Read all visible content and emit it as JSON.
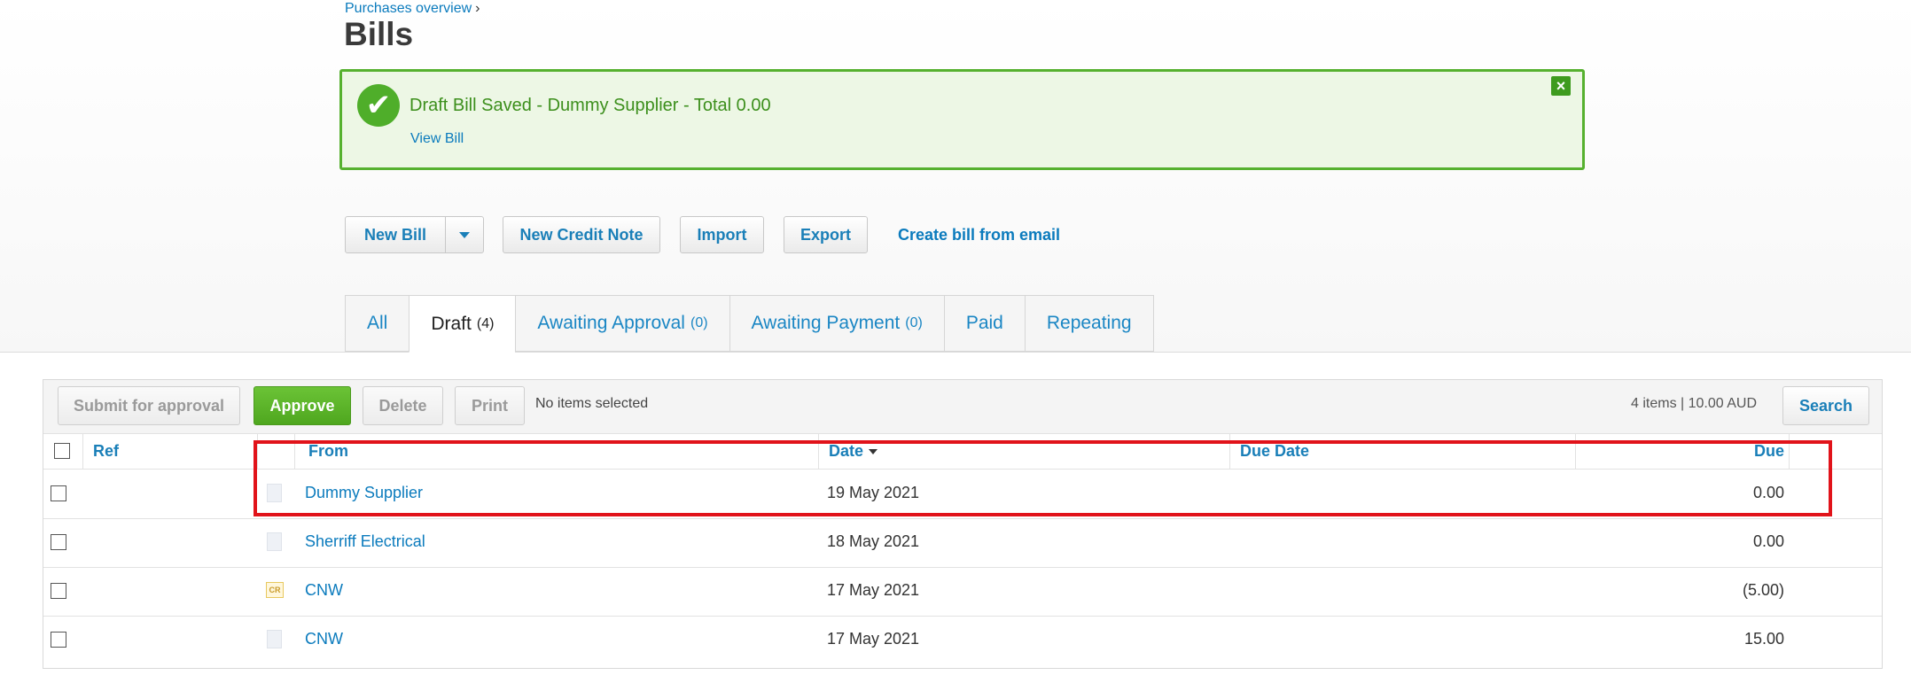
{
  "breadcrumb": {
    "parent": "Purchases overview",
    "separator": "›"
  },
  "page": {
    "title": "Bills"
  },
  "notice": {
    "message": "Draft Bill Saved - Dummy Supplier - Total 0.00",
    "link": "View Bill",
    "close_icon": "×",
    "check_icon": "✔"
  },
  "actions": {
    "new_bill": "New Bill",
    "new_credit_note": "New Credit Note",
    "import": "Import",
    "export": "Export",
    "create_from_email": "Create bill from email"
  },
  "tabs": [
    {
      "label": "All",
      "count": ""
    },
    {
      "label": "Draft",
      "count": "(4)"
    },
    {
      "label": "Awaiting Approval",
      "count": "(0)"
    },
    {
      "label": "Awaiting Payment",
      "count": "(0)"
    },
    {
      "label": "Paid",
      "count": ""
    },
    {
      "label": "Repeating",
      "count": ""
    }
  ],
  "toolbar": {
    "submit": "Submit for approval",
    "approve": "Approve",
    "delete": "Delete",
    "print": "Print",
    "selection": "No items selected",
    "summary": "4 items | 10.00 AUD",
    "search": "Search"
  },
  "table": {
    "headers": {
      "ref": "Ref",
      "from": "From",
      "date": "Date",
      "due_date": "Due Date",
      "due": "Due"
    },
    "rows": [
      {
        "from": "Dummy Supplier",
        "date": "19 May 2021",
        "due": "0.00",
        "icon": "document-icon"
      },
      {
        "from": "Sherriff Electrical",
        "date": "18 May 2021",
        "due": "0.00",
        "icon": "document-icon"
      },
      {
        "from": "CNW",
        "date": "17 May 2021",
        "due": "(5.00)",
        "icon": "credit-note-icon",
        "icon_text": "CR"
      },
      {
        "from": "CNW",
        "date": "17 May 2021",
        "due": "15.00",
        "icon": "document-icon"
      }
    ]
  },
  "colors": {
    "link": "#0b7bbd",
    "success": "#56b12f",
    "approve": "#5cb82a",
    "highlight": "#e1131a"
  }
}
